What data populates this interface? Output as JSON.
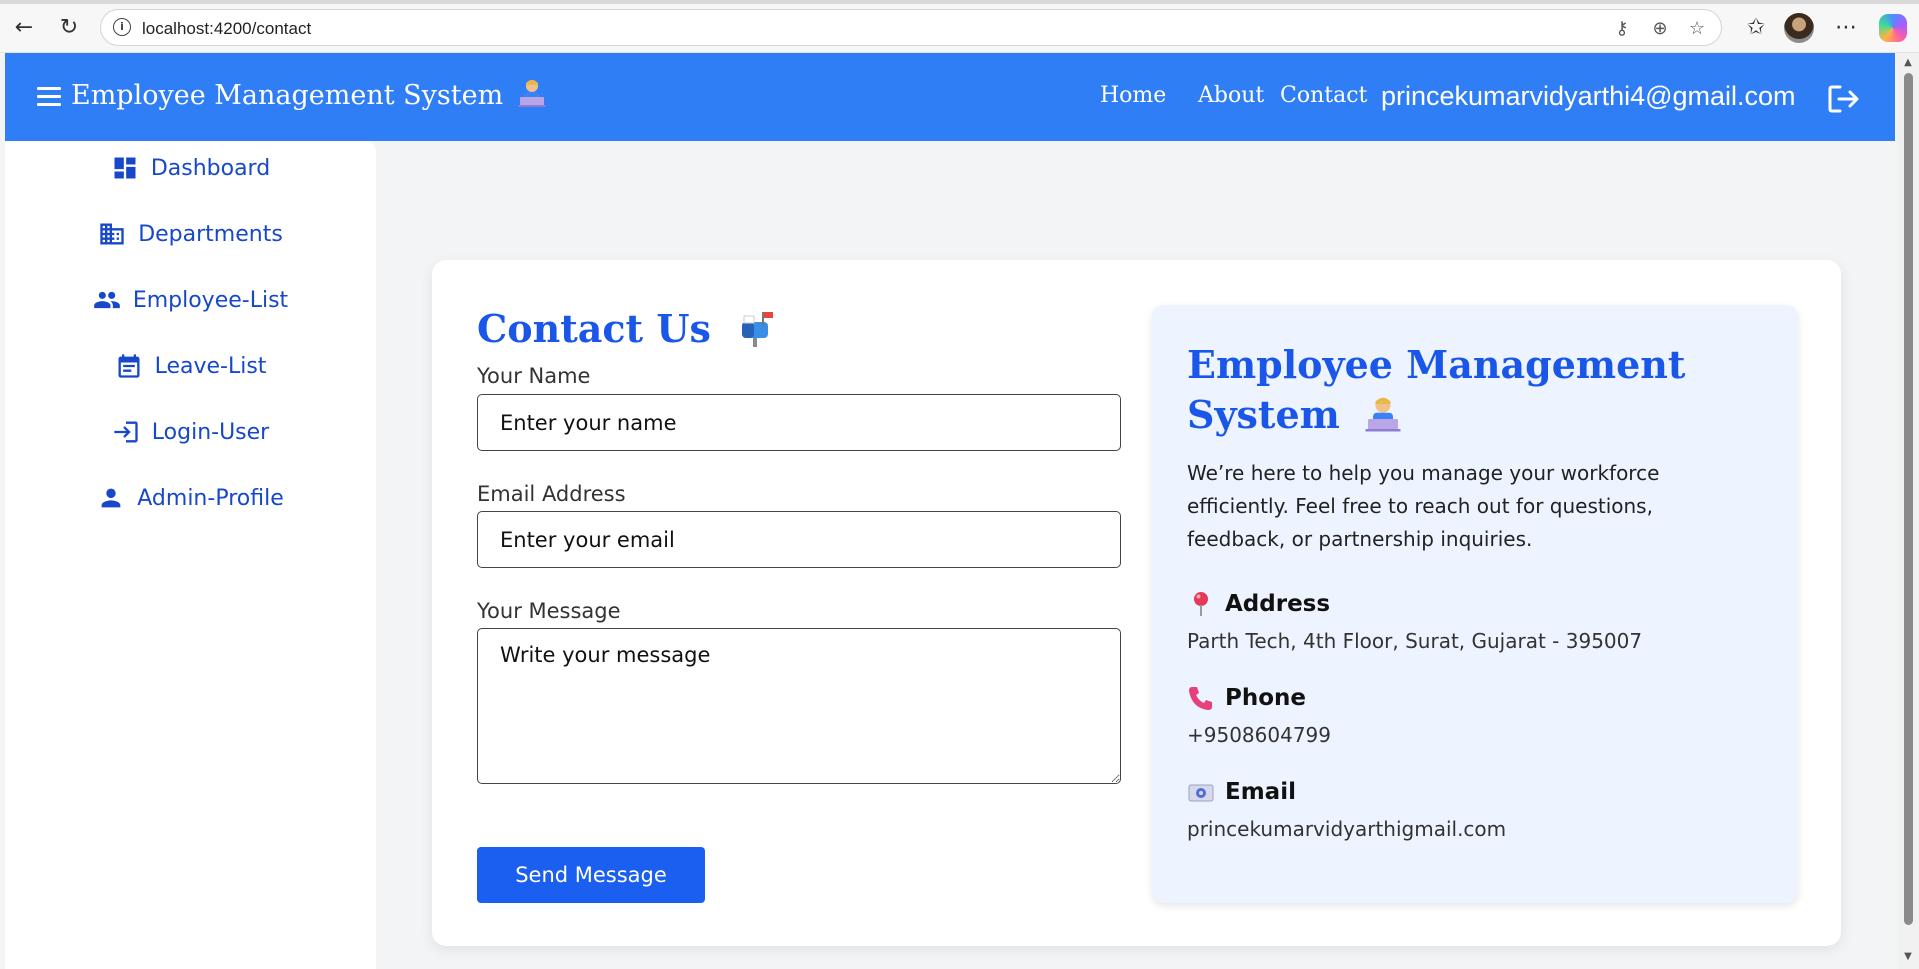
{
  "browser": {
    "url": "localhost:4200/contact"
  },
  "navbar": {
    "brand": "Employee Management System",
    "links": [
      "Home",
      "About",
      "Contact"
    ],
    "user_email": "princekumarvidyarthi4@gmail.com"
  },
  "sidebar": {
    "items": [
      {
        "label": "Dashboard",
        "icon": "dashboard-icon"
      },
      {
        "label": "Departments",
        "icon": "building-icon"
      },
      {
        "label": "Employee-List",
        "icon": "people-icon"
      },
      {
        "label": "Leave-List",
        "icon": "calendar-icon"
      },
      {
        "label": "Login-User",
        "icon": "login-icon"
      },
      {
        "label": "Admin-Profile",
        "icon": "person-icon"
      }
    ]
  },
  "contact_form": {
    "title": "Contact Us",
    "name_label": "Your Name",
    "name_placeholder": "Enter your name",
    "email_label": "Email Address",
    "email_placeholder": "Enter your email",
    "message_label": "Your Message",
    "message_placeholder": "Write your message",
    "submit_label": "Send Message"
  },
  "info_panel": {
    "title": "Employee Management System",
    "description": "We’re here to help you manage your workforce efficiently. Feel free to reach out for questions, feedback, or partnership inquiries.",
    "address_label": "Address",
    "address_value": "Parth Tech, 4th Floor, Surat, Gujarat - 395007",
    "phone_label": "Phone",
    "phone_value": "+9508604799",
    "email_label": "Email",
    "email_value": "princekumarvidyarthigmail.com"
  },
  "colors": {
    "navbar": "#2f7ef5",
    "accent": "#1a57e8",
    "sidebar_text": "#1748c9",
    "button": "#1a5ff0",
    "info_panel_bg": "#edf4ff"
  }
}
